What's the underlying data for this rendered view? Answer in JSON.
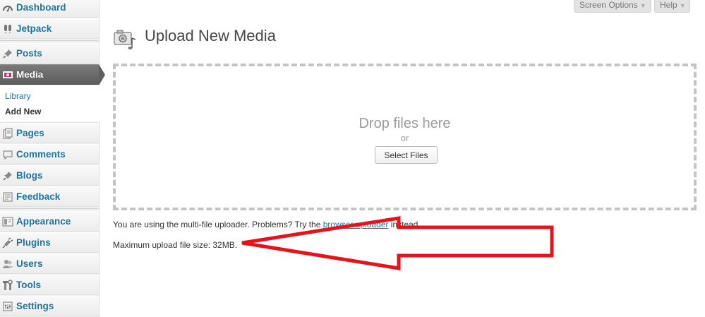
{
  "sidebar": {
    "items": {
      "dashboard": {
        "label": "Dashboard",
        "icon": "dashboard-icon"
      },
      "jetpack": {
        "label": "Jetpack",
        "icon": "jetpack-icon"
      },
      "posts": {
        "label": "Posts",
        "icon": "pushpin-icon"
      },
      "media": {
        "label": "Media",
        "icon": "media-icon",
        "current": true
      },
      "pages": {
        "label": "Pages",
        "icon": "pages-icon"
      },
      "comments": {
        "label": "Comments",
        "icon": "comment-bubble-icon"
      },
      "blogs": {
        "label": "Blogs",
        "icon": "pushpin-icon"
      },
      "feedback": {
        "label": "Feedback",
        "icon": "feedback-icon"
      },
      "appearance": {
        "label": "Appearance",
        "icon": "appearance-icon"
      },
      "plugins": {
        "label": "Plugins",
        "icon": "plugin-icon"
      },
      "users": {
        "label": "Users",
        "icon": "users-icon"
      },
      "tools": {
        "label": "Tools",
        "icon": "tools-icon"
      },
      "settings": {
        "label": "Settings",
        "icon": "settings-icon"
      }
    },
    "media_submenu": [
      {
        "label": "Library",
        "active": false
      },
      {
        "label": "Add New",
        "active": true
      }
    ]
  },
  "header": {
    "screen_options_label": "Screen Options",
    "help_label": "Help"
  },
  "main": {
    "page_title": "Upload New Media",
    "drop_text": "Drop files here",
    "or_text": "or",
    "select_files_label": "Select Files",
    "uploader_note_before": "You are using the multi-file uploader. Problems? Try the ",
    "uploader_note_link": "browser uploader",
    "uploader_note_after": " instead.",
    "max_upload_text": "Maximum upload file size: 32MB."
  },
  "colors": {
    "link": "#21759b",
    "current_menu_bg": "#5f5f5f",
    "annotation_arrow": "#e8131a"
  }
}
